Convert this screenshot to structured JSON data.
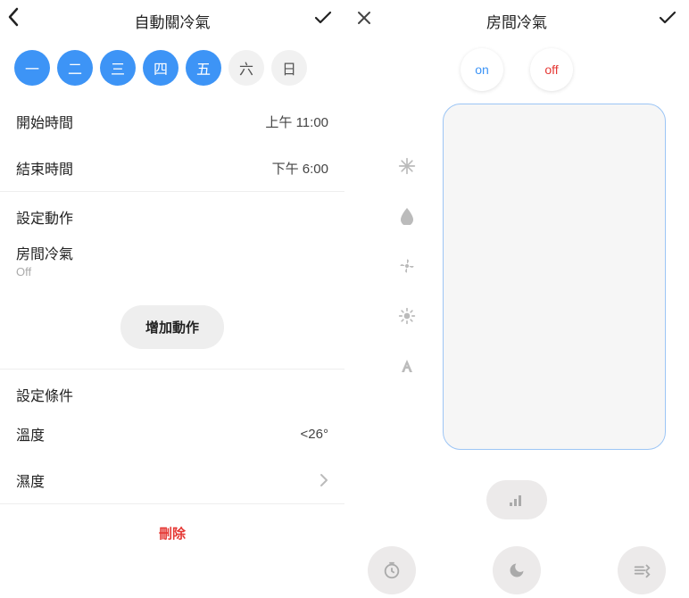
{
  "left": {
    "title": "自動關冷氣",
    "days": [
      {
        "label": "一",
        "active": true
      },
      {
        "label": "二",
        "active": true
      },
      {
        "label": "三",
        "active": true
      },
      {
        "label": "四",
        "active": true
      },
      {
        "label": "五",
        "active": true
      },
      {
        "label": "六",
        "active": false
      },
      {
        "label": "日",
        "active": false
      }
    ],
    "start_label": "開始時間",
    "start_value": "上午 11:00",
    "end_label": "結束時間",
    "end_value": "下午 6:00",
    "actions_header": "設定動作",
    "device_name": "房間冷氣",
    "device_state": "Off",
    "add_action": "增加動作",
    "conditions_header": "設定條件",
    "temp_label": "溫度",
    "temp_value": "<26°",
    "humidity_label": "濕度",
    "delete": "刪除"
  },
  "right": {
    "title": "房間冷氣",
    "on_label": "on",
    "off_label": "off"
  }
}
